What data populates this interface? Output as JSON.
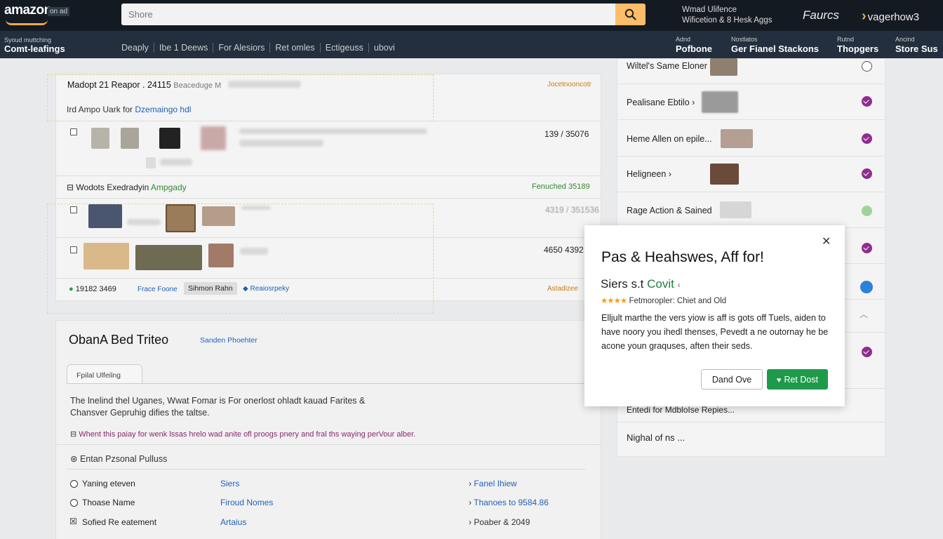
{
  "header": {
    "logo": "amazon",
    "logo_sub": "on ad",
    "search_placeholder": "Shore",
    "notice_line1": "Wmad Ulifence",
    "notice_line2": "Wificetion & 8 Hesk Aggs",
    "brand1": "Faurcs",
    "brand2": "vagerhow3"
  },
  "nav": {
    "location_small": "Syoud muttching",
    "location_big": "Comt-leafings",
    "links": [
      "Deaply",
      "Ibe 1 Deews",
      "For Alesiors",
      "Ret omles",
      "Ectigeuss",
      "ubovi"
    ],
    "account": [
      {
        "small": "Adnd",
        "big": "Pofbone"
      },
      {
        "small": "Nostlatos",
        "big": "Ger Fianel Stackons"
      },
      {
        "small": "Rutnd",
        "big": "Thopgers"
      },
      {
        "small": "Ancind",
        "big": "Store Sus"
      }
    ]
  },
  "order": {
    "title": "Madopt 21 Reapor . 24115",
    "title_suffix": "Beaceduge M",
    "top_right_link": "Jocetnooncotr",
    "subline_prefix": "Ird Ampo Uark for",
    "subline_link": "Dzemaingo hdl",
    "row1_price": "139 / 35076",
    "section_label": "Wodots Exedradyin",
    "section_link": "Ampgady",
    "section_status": "Fenuched 35189",
    "row2_price": "4319 / 351536",
    "row3_price": "4650 4392",
    "footer_id": "19182 3469",
    "footer_link1": "Frace Foone",
    "footer_button": "Sihmon Rahn",
    "footer_link2": "Reaiosrpeky",
    "footer_right": "Astadizee"
  },
  "section2": {
    "title": "ObanA Bed Triteo",
    "title_link": "Sanden Phoehter",
    "tab": "Fpilal Ulfeilng",
    "para_line1": "The lnelind thel Uganes, Wwat Fomar is For onerlost ohladt kauad Farites &",
    "para_line2": "Chansver Gepruhig difies the taltse.",
    "note": "Whent this paiay for wenk lssas hrelo wad anite ofl proogs pnery and fral ths waying perVour alber.",
    "subheading": "Entan Pzsonal Pulluss",
    "rows": [
      {
        "label": "Yaning eteven",
        "mid": "Siers",
        "right": "Fanel Ihiew"
      },
      {
        "label": "Thoase Name",
        "mid": "Firoud Nomes",
        "right": "Thanoes to 9584.86"
      },
      {
        "label": "Sofied Re eatement",
        "mid": "Artaius",
        "right": "Poaber & 2049"
      }
    ]
  },
  "sidebar": {
    "items": [
      {
        "label": "Wiltel's Same Eloner",
        "status": "outline"
      },
      {
        "label": "Pealisane Ebtilo ›",
        "status": "purple"
      },
      {
        "label": "Heme Allen on epile...",
        "status": "purple"
      },
      {
        "label": "Heligneen ›",
        "status": "purple"
      },
      {
        "label": "Rage Action & Sained",
        "status": "green"
      },
      {
        "label": "",
        "status": "purple"
      },
      {
        "label": "",
        "status": "blue"
      },
      {
        "label": "",
        "status": "purple"
      }
    ],
    "bottom1": "Entedi for MdbloIse Repies...",
    "bottom2": "Nighal of ns ..."
  },
  "modal": {
    "title": "Pas & Heahswes, Aff for!",
    "subtitle_dark": "Siers s.t",
    "subtitle_green": "Covit",
    "stars": "★★★★",
    "stars_text": "Fetmoropler: Chiet and Old",
    "body": "Elljult marthe the vers yiow is aff is gots off Tuels, aiden to have noory you ihedl thenses, Pevedt a ne outornay he be acone youn graquses, aften their seds.",
    "btn_secondary": "Dand Ove",
    "btn_primary": "Ret Dost",
    "colors": {
      "primary": "#1e9a4a",
      "accent": "#febd69",
      "purple": "#8e2d8f"
    }
  }
}
